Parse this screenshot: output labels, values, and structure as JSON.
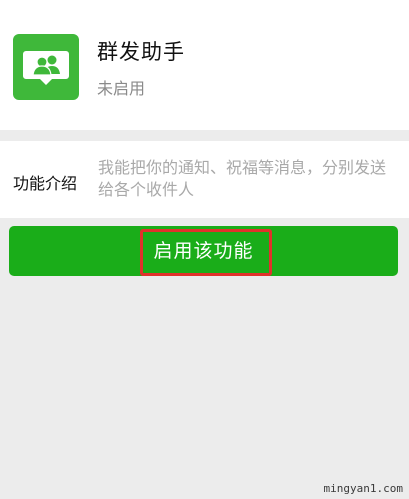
{
  "app": {
    "name": "群发助手",
    "status": "未启用",
    "icon": "group-people-icon",
    "icon_color": "#3fb83a"
  },
  "intro": {
    "label": "功能介绍",
    "text": "我能把你的通知、祝福等消息，分别发送给各个收件人"
  },
  "action": {
    "enable_label": "启用该功能",
    "button_color": "#1aad19",
    "highlight_color": "#e0322b"
  },
  "watermark": "mingyan1.com"
}
